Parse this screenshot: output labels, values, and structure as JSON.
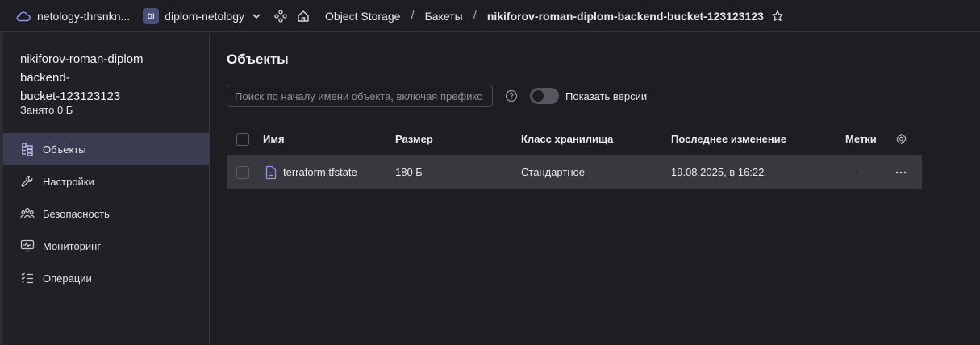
{
  "topbar": {
    "cloud_name": "netology-thrsnkn...",
    "folder_badge": "DI",
    "folder_name": "diplom-netology",
    "service": "Object Storage",
    "buckets": "Бакеты",
    "bucket_name": "nikiforov-roman-diplom-backend-bucket-123123123",
    "separator": "/"
  },
  "sidebar": {
    "bucket_title": "nikiforov-roman-diplom-backend-bucket-123123123",
    "used": "Занято 0 Б",
    "items": [
      {
        "label": "Объекты",
        "icon": "objects-icon"
      },
      {
        "label": "Настройки",
        "icon": "wrench-icon"
      },
      {
        "label": "Безопасность",
        "icon": "users-icon"
      },
      {
        "label": "Мониторинг",
        "icon": "monitor-icon"
      },
      {
        "label": "Операции",
        "icon": "list-icon"
      }
    ]
  },
  "main": {
    "title": "Объекты",
    "search_placeholder": "Поиск по началу имени объекта, включая префикс",
    "toggle_label": "Показать версии",
    "toggle_on": false,
    "columns": [
      "Имя",
      "Размер",
      "Класс хранилища",
      "Последнее изменение",
      "Метки"
    ],
    "rows": [
      {
        "name": "terraform.tfstate",
        "size": "180 Б",
        "class": "Стандартное",
        "modified": "19.08.2025, в 16:22",
        "labels": "—"
      }
    ]
  },
  "colors": {
    "background": "#1e1e22",
    "active_nav": "#3a3d52",
    "row_highlight": "#38383e",
    "file_icon": "#8b93ff"
  }
}
